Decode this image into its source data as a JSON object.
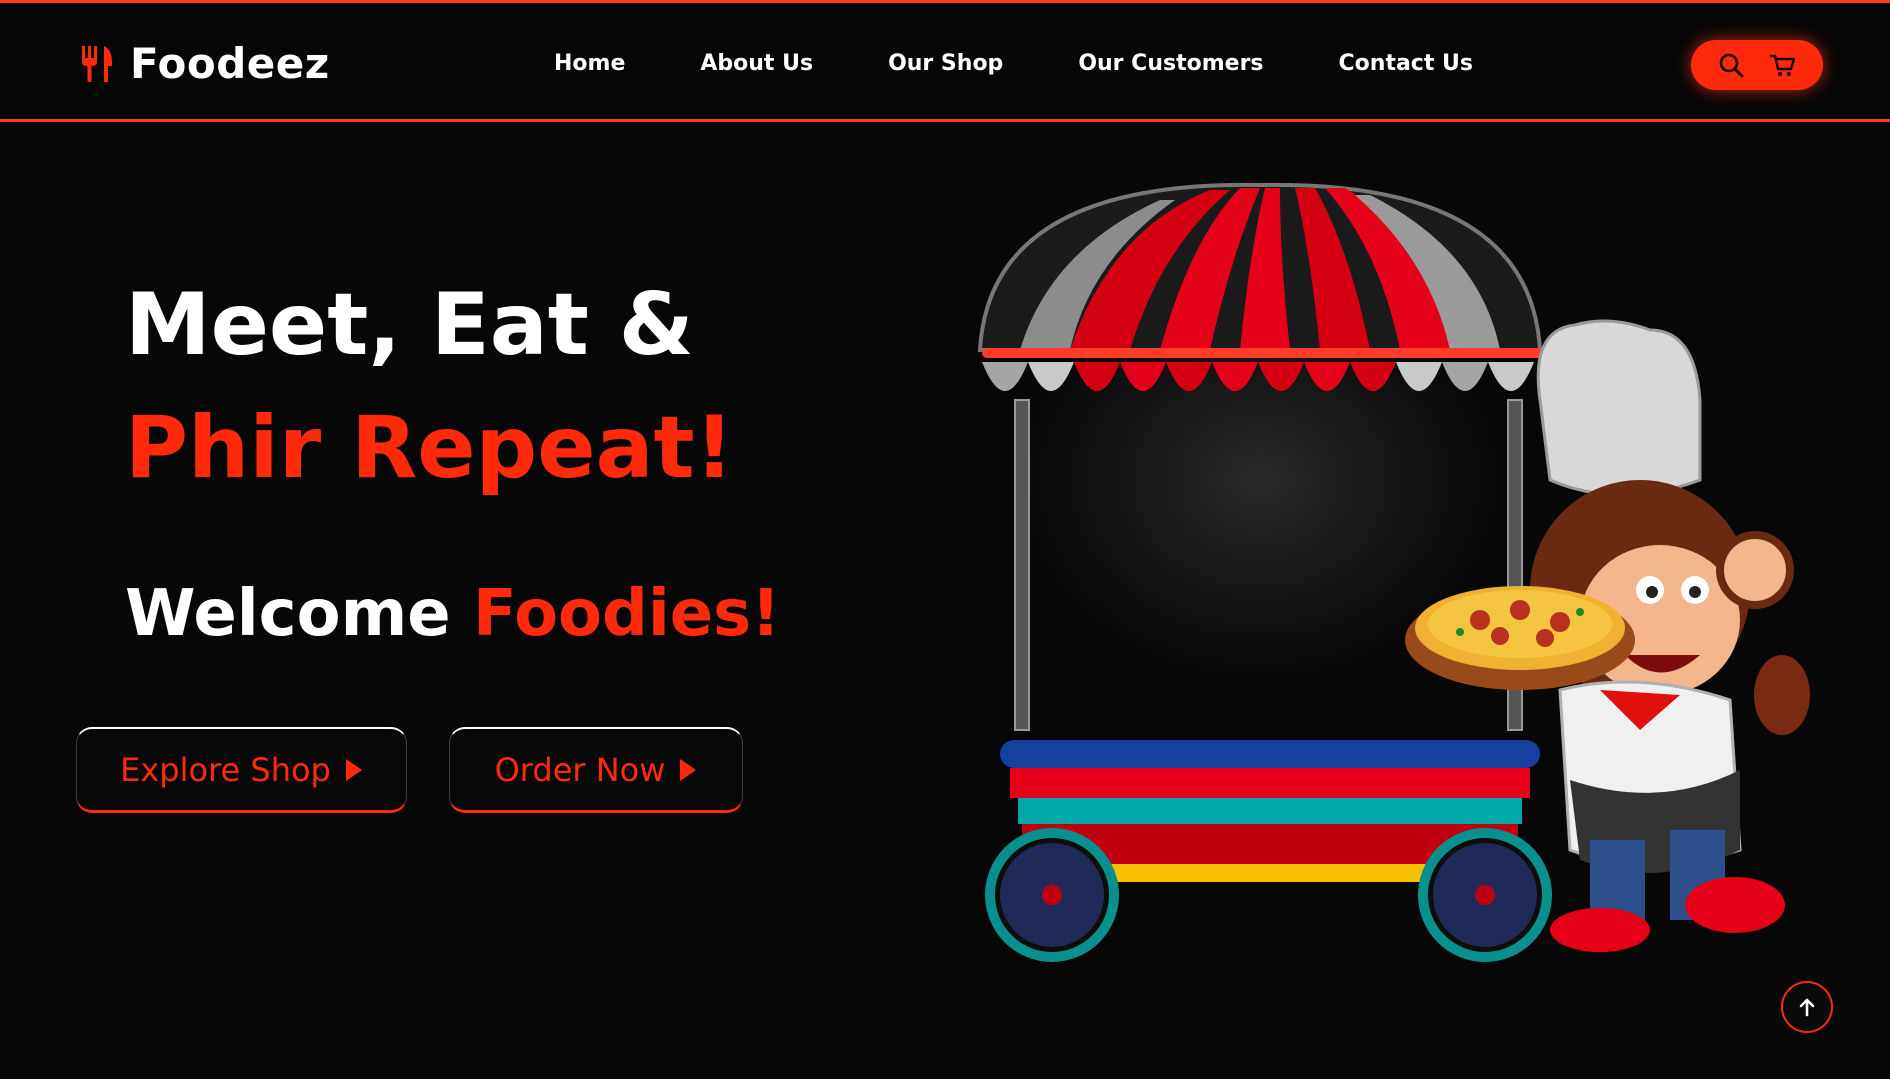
{
  "brand": {
    "name": "Foodeez",
    "icon": "fork-knife-icon",
    "accent_color": "#ff2a0c"
  },
  "nav": {
    "items": [
      {
        "label": "Home"
      },
      {
        "label": "About Us"
      },
      {
        "label": "Our Shop"
      },
      {
        "label": "Our Customers"
      },
      {
        "label": "Contact Us"
      }
    ]
  },
  "header_actions": {
    "search_icon": "search-icon",
    "cart_icon": "cart-icon"
  },
  "hero": {
    "line1": "Meet, Eat &",
    "line2": "Phir Repeat!",
    "welcome_white": "Welcome",
    "welcome_accent": "Foodies!",
    "buttons": [
      {
        "label": "Explore Shop",
        "icon": "play-icon"
      },
      {
        "label": "Order Now",
        "icon": "play-icon"
      }
    ],
    "illustration": "monkey chef with pizza beside food cart"
  },
  "scroll_top": {
    "icon": "arrow-up-icon"
  }
}
